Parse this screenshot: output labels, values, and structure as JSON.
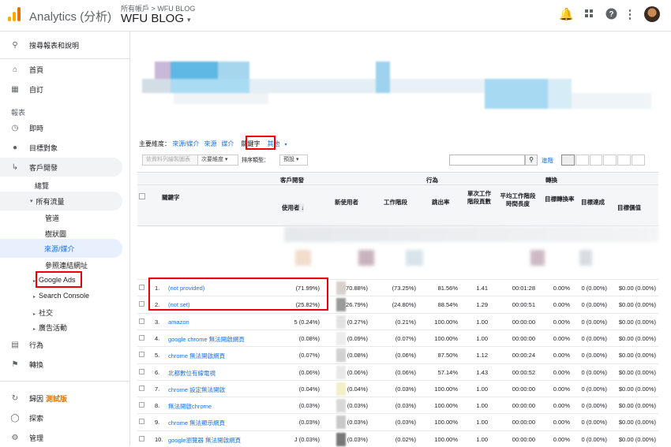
{
  "app": {
    "title": "Analytics (分析)"
  },
  "breadcrumb": {
    "parent": "所有帳戶",
    "sep": ">",
    "current": "WFU BLOG"
  },
  "account": {
    "name": "WFU BLOG",
    "caret": "▾"
  },
  "topbar_icons": [
    "bell-icon",
    "apps-icon",
    "help-icon",
    "more-vert-icon"
  ],
  "sidebar": {
    "search": "搜尋報表和說明",
    "home": "首頁",
    "custom": "自訂",
    "reports_header": "報表",
    "realtime": "即時",
    "audience": "目標對象",
    "acquisition": "客戶開發",
    "overview": "總覽",
    "all_traffic": "所有流量",
    "channels": "管道",
    "treemap": "樹狀圖",
    "source_medium": "來源/媒介",
    "referrals": "參照連結網址",
    "google_ads": "Google Ads",
    "search_console": "Search Console",
    "social": "社交",
    "campaigns": "廣告活動",
    "behavior": "行為",
    "conversions": "轉換",
    "attribution": "歸因",
    "beta": "測試版",
    "discover": "探索",
    "admin": "管理"
  },
  "dimensions": {
    "label": "主要維度：",
    "items": [
      "來源/媒介",
      "來源",
      "媒介",
      "關鍵字",
      "其他"
    ],
    "selected": "關鍵字"
  },
  "controls": {
    "plot_rows": "依資料列繪製圖表",
    "secondary": "次要維度",
    "sort_label": "排序類型：",
    "sort_value": "預設",
    "advanced": "進階"
  },
  "table": {
    "group_acq": "客戶開發",
    "group_beh": "行為",
    "group_conv": "轉換",
    "col_keyword": "關鍵字",
    "cols": [
      "使用者",
      "新使用者",
      "工作階段",
      "跳出率",
      "單次工作階段頁數",
      "平均工作階段時間長度",
      "目標轉換率",
      "目標達成",
      "目標價值"
    ],
    "rows": [
      {
        "n": "1.",
        "kw": "(not provided)",
        "users": "(71.99%)",
        "newu": "(70.88%)",
        "sess": "(73.25%)",
        "bounce": "81.56%",
        "pps": "1.41",
        "dur": "00:01:28",
        "cr": "0.00%",
        "comp": "0 (0.00%)",
        "val": "$0.00 (0.00%)"
      },
      {
        "n": "2.",
        "kw": "(not set)",
        "users": "(25.82%)",
        "newu": "(26.79%)",
        "sess": "(24.80%)",
        "bounce": "88.54%",
        "pps": "1.29",
        "dur": "00:00:51",
        "cr": "0.00%",
        "comp": "0 (0.00%)",
        "val": "$0.00 (0.00%)"
      },
      {
        "n": "3.",
        "kw": "amazon",
        "users": "5 (0.24%)",
        "newu": "(0.27%)",
        "sess": "(0.21%)",
        "bounce": "100.00%",
        "pps": "1.00",
        "dur": "00:00:00",
        "cr": "0.00%",
        "comp": "0 (0.00%)",
        "val": "$0.00 (0.00%)"
      },
      {
        "n": "4.",
        "kw": "google chrome 無法開啟網頁",
        "users": "(0.08%)",
        "newu": "(0.09%)",
        "sess": "(0.07%)",
        "bounce": "100.00%",
        "pps": "1.00",
        "dur": "00:00:00",
        "cr": "0.00%",
        "comp": "0 (0.00%)",
        "val": "$0.00 (0.00%)"
      },
      {
        "n": "5.",
        "kw": "chrome 無法開啟網頁",
        "users": "(0.07%)",
        "newu": "(0.08%)",
        "sess": "(0.06%)",
        "bounce": "87.50%",
        "pps": "1.12",
        "dur": "00:00:24",
        "cr": "0.00%",
        "comp": "0 (0.00%)",
        "val": "$0.00 (0.00%)"
      },
      {
        "n": "6.",
        "kw": "北都數位有線電視",
        "users": "(0.06%)",
        "newu": "(0.06%)",
        "sess": "(0.06%)",
        "bounce": "57.14%",
        "pps": "1.43",
        "dur": "00:00:52",
        "cr": "0.00%",
        "comp": "0 (0.00%)",
        "val": "$0.00 (0.00%)"
      },
      {
        "n": "7.",
        "kw": "chrome 設定無法開啟",
        "users": "(0.04%)",
        "newu": "(0.04%)",
        "sess": "(0.03%)",
        "bounce": "100.00%",
        "pps": "1.00",
        "dur": "00:00:00",
        "cr": "0.00%",
        "comp": "0 (0.00%)",
        "val": "$0.00 (0.00%)"
      },
      {
        "n": "8.",
        "kw": "無法開啟chrome",
        "users": "(0.03%)",
        "newu": "(0.03%)",
        "sess": "(0.03%)",
        "bounce": "100.00%",
        "pps": "1.00",
        "dur": "00:00:00",
        "cr": "0.00%",
        "comp": "0 (0.00%)",
        "val": "$0.00 (0.00%)"
      },
      {
        "n": "9.",
        "kw": "chrome 無法顯示網頁",
        "users": "(0.03%)",
        "newu": "(0.03%)",
        "sess": "(0.03%)",
        "bounce": "100.00%",
        "pps": "1.00",
        "dur": "00:00:00",
        "cr": "0.00%",
        "comp": "0 (0.00%)",
        "val": "$0.00 (0.00%)"
      },
      {
        "n": "10.",
        "kw": "google瀏覽器 無法開啟網頁",
        "users": "J (0.03%)",
        "newu": "(0.03%)",
        "sess": "(0.02%)",
        "bounce": "100.00%",
        "pps": "1.00",
        "dur": "00:00:00",
        "cr": "0.00%",
        "comp": "0 (0.00%)",
        "val": "$0.00 (0.00%)"
      }
    ]
  },
  "colors": {
    "accent": "#1a73e8",
    "highlight": "#e00000",
    "nav_active": "#e8f0fe"
  }
}
